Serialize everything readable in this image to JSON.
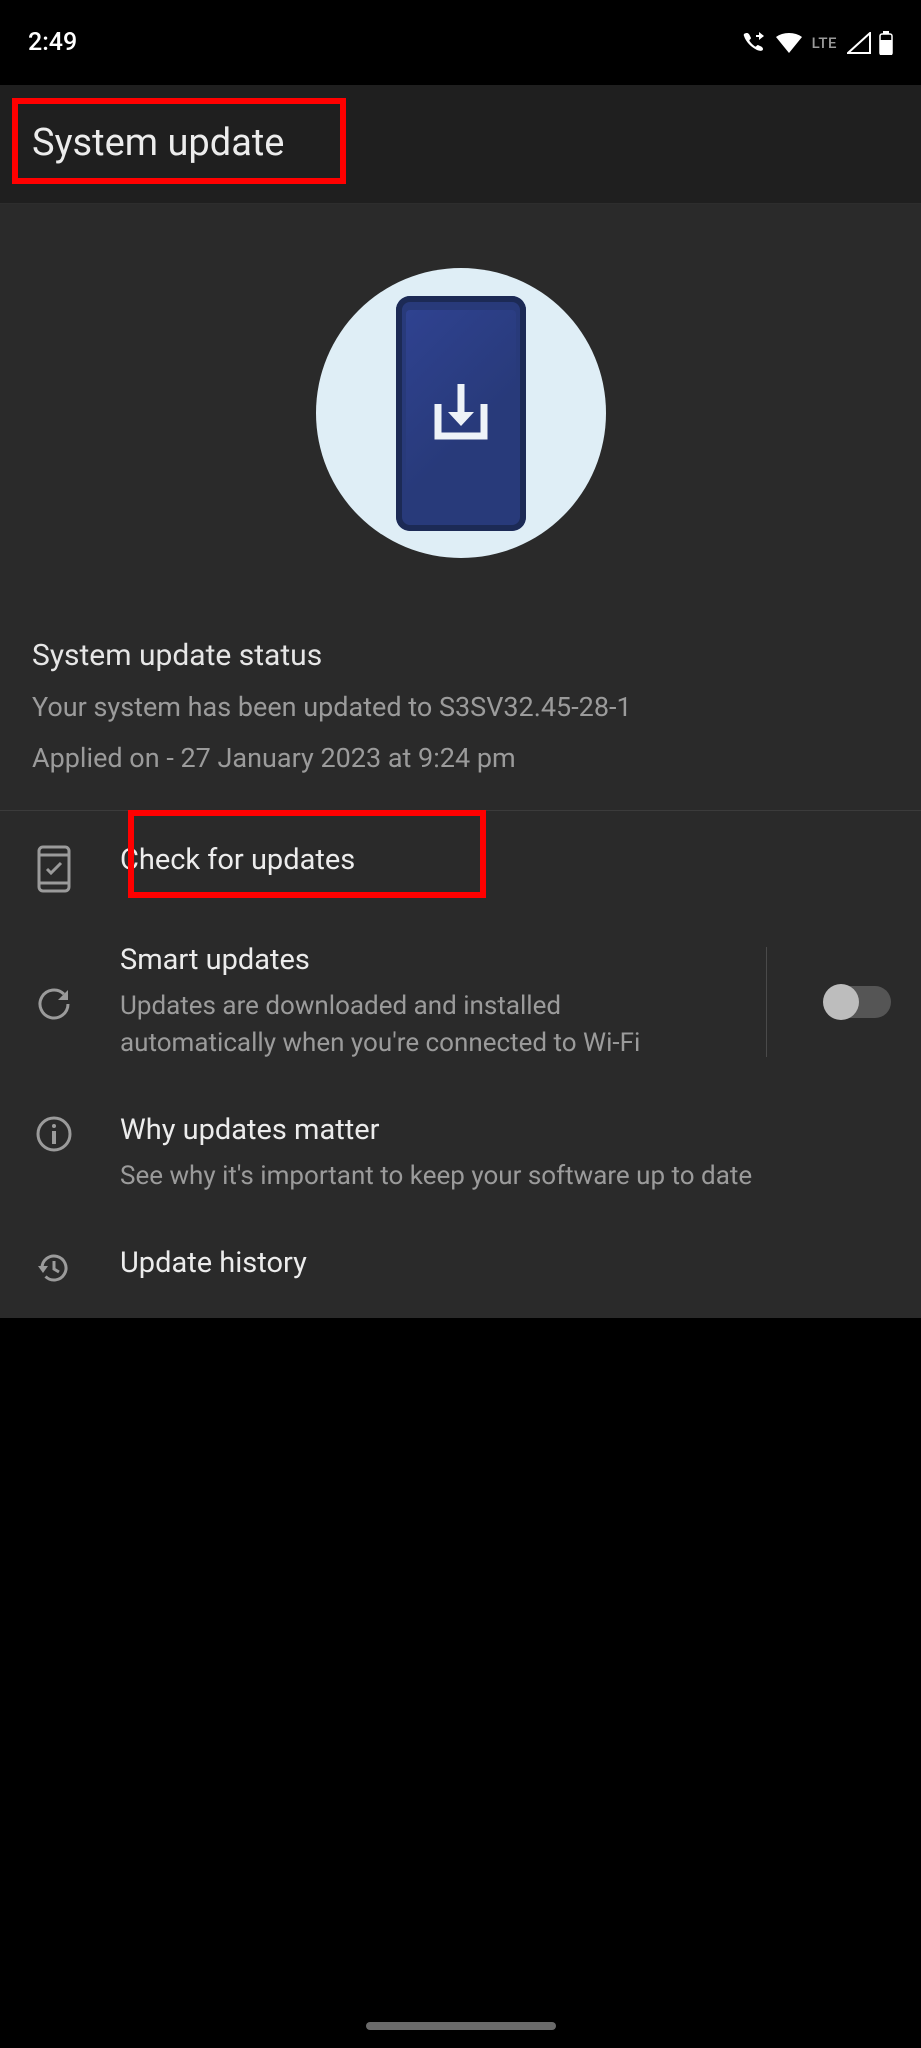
{
  "status_bar": {
    "time": "2:49",
    "network_label": "LTE"
  },
  "header": {
    "title": "System update"
  },
  "status_section": {
    "heading": "System update status",
    "subtitle": "Your system has been updated to S3SV32.45-28-1",
    "applied": "Applied on - 27 January 2023 at 9:24 pm"
  },
  "rows": {
    "check": {
      "title": "Check for updates"
    },
    "smart": {
      "title": "Smart updates",
      "desc": "Updates are downloaded and installed automatically when you're connected to Wi-Fi",
      "enabled": false
    },
    "why": {
      "title": "Why updates matter",
      "desc": "See why it's important to keep your software up to date"
    },
    "history": {
      "title": "Update history"
    }
  }
}
